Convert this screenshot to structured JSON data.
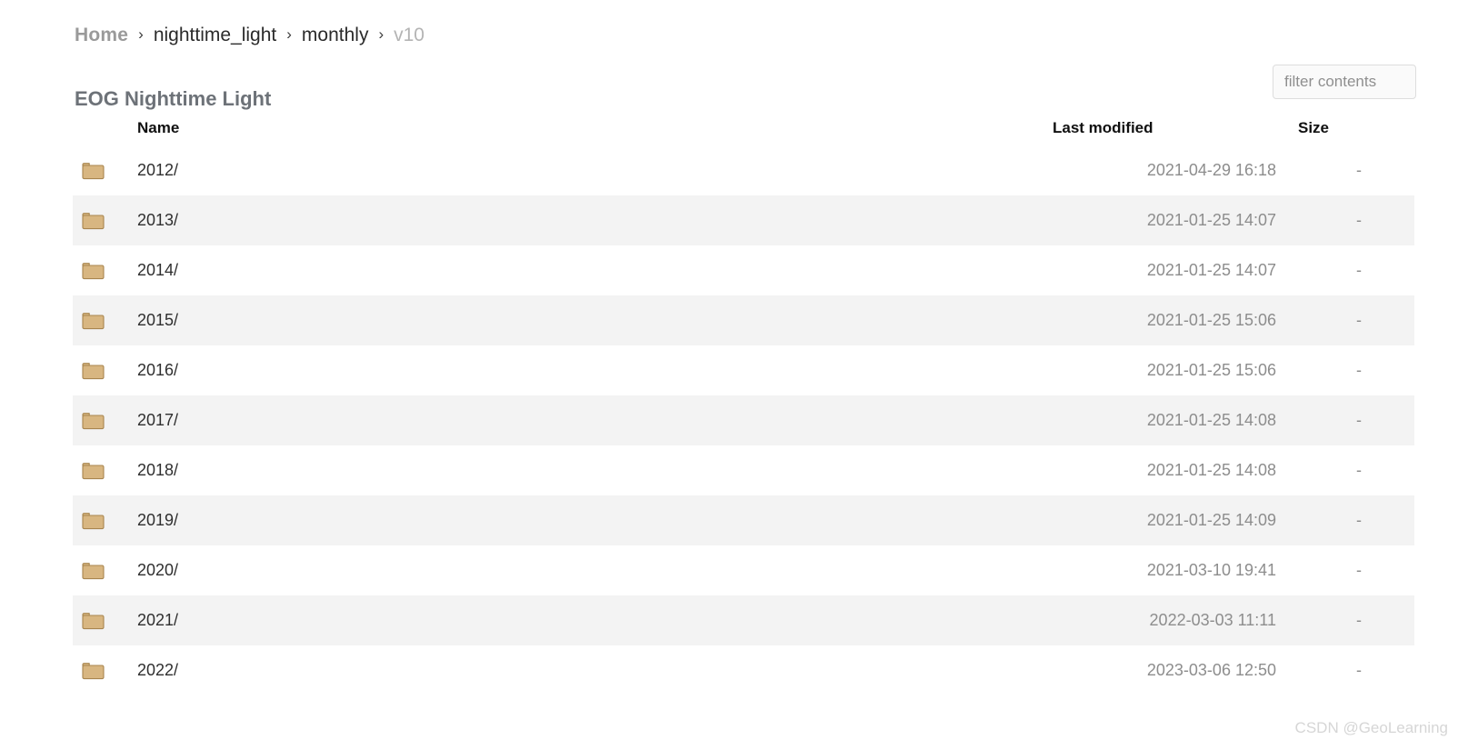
{
  "breadcrumb": {
    "separator": "›",
    "items": [
      {
        "label": "Home",
        "type": "root"
      },
      {
        "label": "nighttime_light",
        "type": "link"
      },
      {
        "label": "monthly",
        "type": "link"
      },
      {
        "label": "v10",
        "type": "current"
      }
    ]
  },
  "header": {
    "title": "EOG Nighttime Light"
  },
  "filter": {
    "placeholder": "filter contents",
    "value": ""
  },
  "table": {
    "columns": {
      "name": "Name",
      "last_modified": "Last modified",
      "size": "Size"
    },
    "rows": [
      {
        "icon": "folder-icon",
        "name": "2012/",
        "last_modified": "2021-04-29 16:18",
        "size": "-"
      },
      {
        "icon": "folder-icon",
        "name": "2013/",
        "last_modified": "2021-01-25 14:07",
        "size": "-"
      },
      {
        "icon": "folder-icon",
        "name": "2014/",
        "last_modified": "2021-01-25 14:07",
        "size": "-"
      },
      {
        "icon": "folder-icon",
        "name": "2015/",
        "last_modified": "2021-01-25 15:06",
        "size": "-"
      },
      {
        "icon": "folder-icon",
        "name": "2016/",
        "last_modified": "2021-01-25 15:06",
        "size": "-"
      },
      {
        "icon": "folder-icon",
        "name": "2017/",
        "last_modified": "2021-01-25 14:08",
        "size": "-"
      },
      {
        "icon": "folder-icon",
        "name": "2018/",
        "last_modified": "2021-01-25 14:08",
        "size": "-"
      },
      {
        "icon": "folder-icon",
        "name": "2019/",
        "last_modified": "2021-01-25 14:09",
        "size": "-"
      },
      {
        "icon": "folder-icon",
        "name": "2020/",
        "last_modified": "2021-03-10 19:41",
        "size": "-"
      },
      {
        "icon": "folder-icon",
        "name": "2021/",
        "last_modified": "2022-03-03 11:11",
        "size": "-"
      },
      {
        "icon": "folder-icon",
        "name": "2022/",
        "last_modified": "2023-03-06 12:50",
        "size": "-"
      }
    ]
  },
  "watermark": {
    "text": "CSDN @GeoLearning"
  },
  "colors": {
    "background": "#ffffff",
    "stripe": "#f3f3f3",
    "folder_fill": "#d8b681",
    "folder_border": "#a8854e",
    "muted_text": "#8d8d8d",
    "title_text": "#6d7278",
    "watermark_text": "#d6d6d6"
  }
}
